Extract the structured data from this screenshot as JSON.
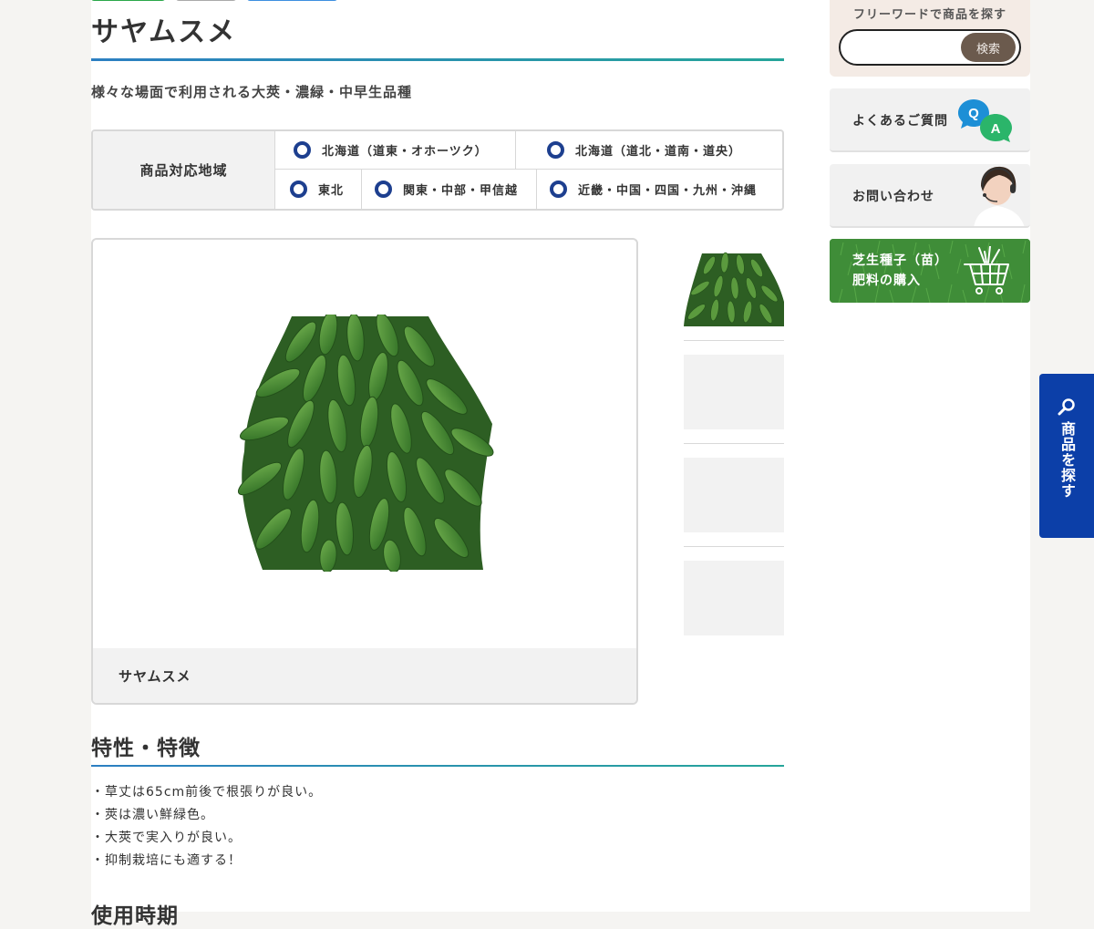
{
  "product": {
    "name": "サヤムスメ",
    "tagline": "様々な場面で利用される大莢・濃緑・中早生品種",
    "image_caption": "サヤムスメ"
  },
  "regions": {
    "header": "商品対応地域",
    "items": [
      "北海道（道東・オホーツク）",
      "北海道（道北・道南・道央）",
      "東北",
      "関東・中部・甲信越",
      "近畿・中国・四国・九州・沖縄"
    ]
  },
  "features": {
    "title": "特性・特徴",
    "items": [
      "・草丈は65cm前後で根張りが良い。",
      "・莢は濃い鮮緑色。",
      "・大莢で実入りが良い。",
      "・抑制栽培にも適する！"
    ]
  },
  "usage": {
    "title": "使用時期"
  },
  "sidebar": {
    "search_label": "フリーワードで商品を探す",
    "search_value": "",
    "search_button": "検索",
    "faq_label": "よくあるご質問",
    "faq_icon_q": "Q",
    "faq_icon_a": "A",
    "contact_label": "お問い合わせ",
    "buy_line1": "芝生種子（苗）",
    "buy_line2": "肥料の購入"
  },
  "floating_tab": {
    "label": "商品を探す"
  },
  "colors": {
    "accent_blue": "#0c3fa8",
    "radio_blue": "#1d3f8f",
    "title_rule_start": "#2c7fc2",
    "title_rule_end": "#26a59a",
    "search_button": "#6b5a4d",
    "buy_card": "#3e8f3a"
  },
  "icons": {
    "faq": "qa-speech-bubbles-icon",
    "contact": "operator-with-headset-icon",
    "buy": "shopping-cart-icon",
    "float": "magnifier-icon",
    "region": "radio-icon"
  }
}
